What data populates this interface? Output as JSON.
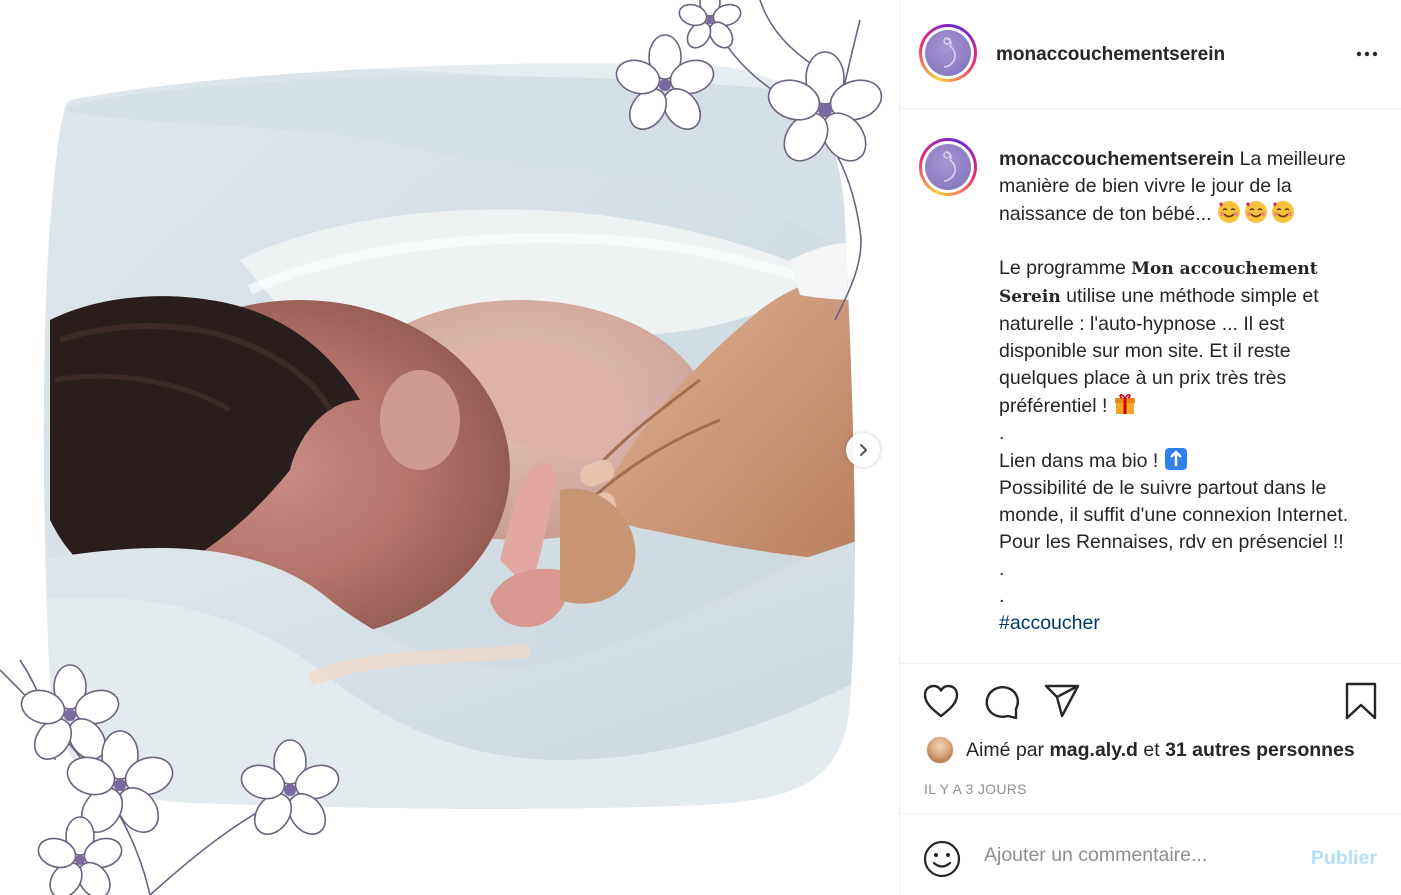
{
  "post": {
    "username": "monaccouchementserein",
    "more_label": "•••"
  },
  "caption": {
    "username": "monaccouchementserein",
    "intro": "La meilleure manière de bien vivre le jour de la naissance de ton bébé...",
    "p1_before": "Le programme ",
    "p1_fancy": "Mon accouchement Serein",
    "p1_after": " utilise une méthode simple et naturelle : l'auto-hypnose ... Il est disponible sur mon site. Et il reste quelques place à un prix très très préférentiel !",
    "dot1": ".",
    "p2": "Lien dans ma bio !",
    "p3": "Possibilité de le suivre partout dans le monde, il suffit d'une connexion Internet. Pour les Rennaises, rdv en présenciel !!",
    "dot2": ".",
    "dot3": ".",
    "hashtag": "#accoucher"
  },
  "likes": {
    "prefix": "Aimé par ",
    "liker": "mag.aly.d",
    "middle": " et ",
    "others": "31 autres personnes"
  },
  "timestamp": "IL Y A 3 JOURS",
  "comment": {
    "placeholder": "Ajouter un commentaire...",
    "publish_label": "Publier"
  },
  "icons": {
    "like": "heart-icon",
    "comment": "comment-bubble-icon",
    "share": "paper-plane-icon",
    "save": "bookmark-icon",
    "emoji": "smiley-icon",
    "next": "chevron-right-icon"
  },
  "colors": {
    "hashtag": "#00376b",
    "publish_disabled": "#b2dffc",
    "muted": "#8e8e8e",
    "flower_line": "#6e6280",
    "flower_center": "#7a6aa0"
  }
}
